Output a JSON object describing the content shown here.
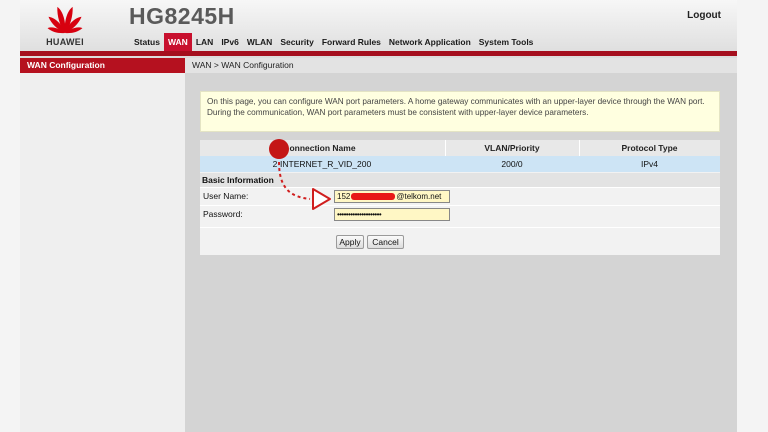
{
  "header": {
    "brand": "HUAWEI",
    "model": "HG8245H",
    "logout": "Logout",
    "nav": [
      "Status",
      "WAN",
      "LAN",
      "IPv6",
      "WLAN",
      "Security",
      "Forward Rules",
      "Network Application",
      "System Tools"
    ],
    "active_nav": "WAN"
  },
  "sidebar": {
    "active_item": "WAN Configuration"
  },
  "breadcrumb": "WAN > WAN Configuration",
  "notice": "On this page, you can configure WAN port parameters. A home gateway communicates with an upper-layer device through the WAN port. During the communication, WAN port parameters must be consistent with upper-layer device parameters.",
  "table": {
    "columns": [
      "onnection Name",
      "VLAN/Priority",
      "Protocol Type"
    ],
    "rows": [
      {
        "index": "2",
        "name": "INTERNET_R_VID_200",
        "vlan": "200/0",
        "protocol": "IPv4"
      }
    ]
  },
  "basic": {
    "title": "Basic Information",
    "username_label": "User Name:",
    "username_prefix": "152",
    "username_suffix": "@telkom.net",
    "password_label": "Password:",
    "password_value": "••••••••••••••••••••"
  },
  "buttons": {
    "apply": "Apply",
    "cancel": "Cancel"
  },
  "colors": {
    "brand_red": "#c8102e",
    "row_highlight": "#cde4f5",
    "input_bg": "#fff7c5",
    "annotation_red": "#d01e1e"
  },
  "icons": {
    "logo": "huawei-petal-logo",
    "arrow": "annotation-arrow"
  }
}
